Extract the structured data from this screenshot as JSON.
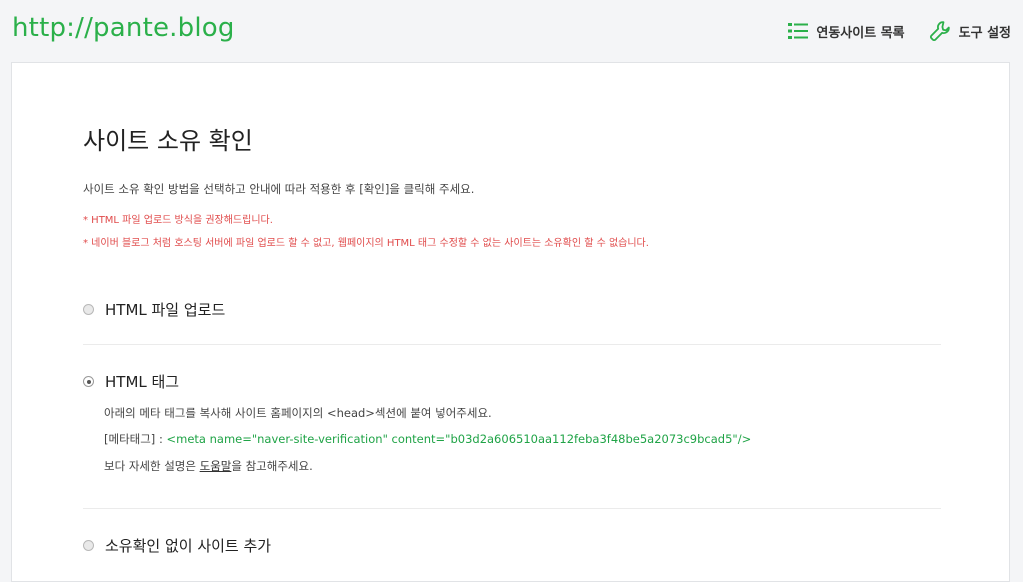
{
  "header": {
    "site_url": "http://pante.blog",
    "sites_list_label": "연동사이트 목록",
    "tool_settings_label": "도구 설정"
  },
  "colors": {
    "brand": "#2bb04a",
    "warning": "#e04b4b",
    "code": "#1fa346"
  },
  "main": {
    "title": "사이트 소유 확인",
    "description": "사이트 소유 확인 방법을 선택하고 안내에 따라 적용한 후 [확인]을 클릭해 주세요.",
    "notes": [
      "* HTML 파일 업로드 방식을 권장해드립니다.",
      "* 네이버 블로그 처럼 호스팅 서버에 파일 업로드 할 수 없고, 웹페이지의 HTML 태그 수정할 수 없는 사이트는 소유확인 할 수 없습니다."
    ],
    "options": [
      {
        "label": "HTML 파일 업로드",
        "selected": false
      },
      {
        "label": "HTML 태그",
        "selected": true
      },
      {
        "label": "소유확인 없이 사이트 추가",
        "selected": false
      }
    ],
    "html_tag": {
      "instruction": "아래의 메타 태그를 복사해 사이트 홈페이지의 <head>섹션에 붙여 넣어주세요.",
      "meta_label": "[메타태그] : ",
      "meta_code": "<meta name=\"naver-site-verification\" content=\"b03d2a606510aa112feba3f48be5a2073c9bcad5\"/>",
      "help_prefix": "보다 자세한 설명은 ",
      "help_link": "도움말",
      "help_suffix": "을 참고해주세요."
    }
  }
}
